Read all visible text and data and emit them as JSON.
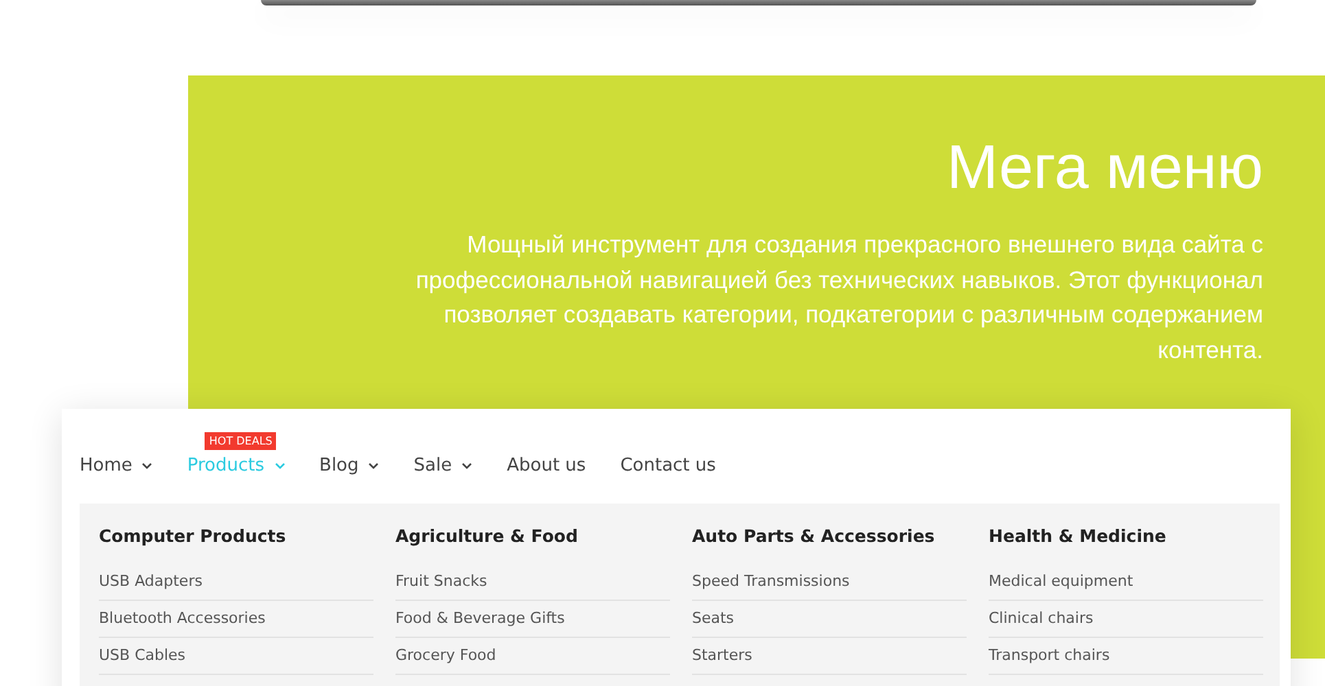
{
  "hero": {
    "title": "Мега меню",
    "description": "Мощный инструмент для создания прекрасного внешнего вида сайта с профессиональной навигацией без технических навыков. Этот функционал позволяет создавать категории, подкатегории с различным содержанием контента."
  },
  "nav": [
    {
      "label": "Home",
      "has_dropdown": true,
      "selected": false
    },
    {
      "label": "Products",
      "has_dropdown": true,
      "selected": true,
      "badge": "HOT DEALS"
    },
    {
      "label": "Blog",
      "has_dropdown": true,
      "selected": false
    },
    {
      "label": "Sale",
      "has_dropdown": true,
      "selected": false
    },
    {
      "label": "About us",
      "has_dropdown": false,
      "selected": false
    },
    {
      "label": "Contact us",
      "has_dropdown": false,
      "selected": false
    }
  ],
  "mega_menu": [
    {
      "heading": "Computer Products",
      "items": [
        "USB Adapters",
        "Bluetooth Accessories",
        "USB Cables"
      ]
    },
    {
      "heading": "Agriculture & Food",
      "items": [
        "Fruit Snacks",
        "Food & Beverage Gifts",
        "Grocery Food"
      ]
    },
    {
      "heading": "Auto Parts & Accessories",
      "items": [
        "Speed Transmissions",
        "Seats",
        "Starters"
      ]
    },
    {
      "heading": "Health & Medicine",
      "items": [
        "Medical equipment",
        "Clinical chairs",
        "Transport chairs"
      ]
    }
  ]
}
